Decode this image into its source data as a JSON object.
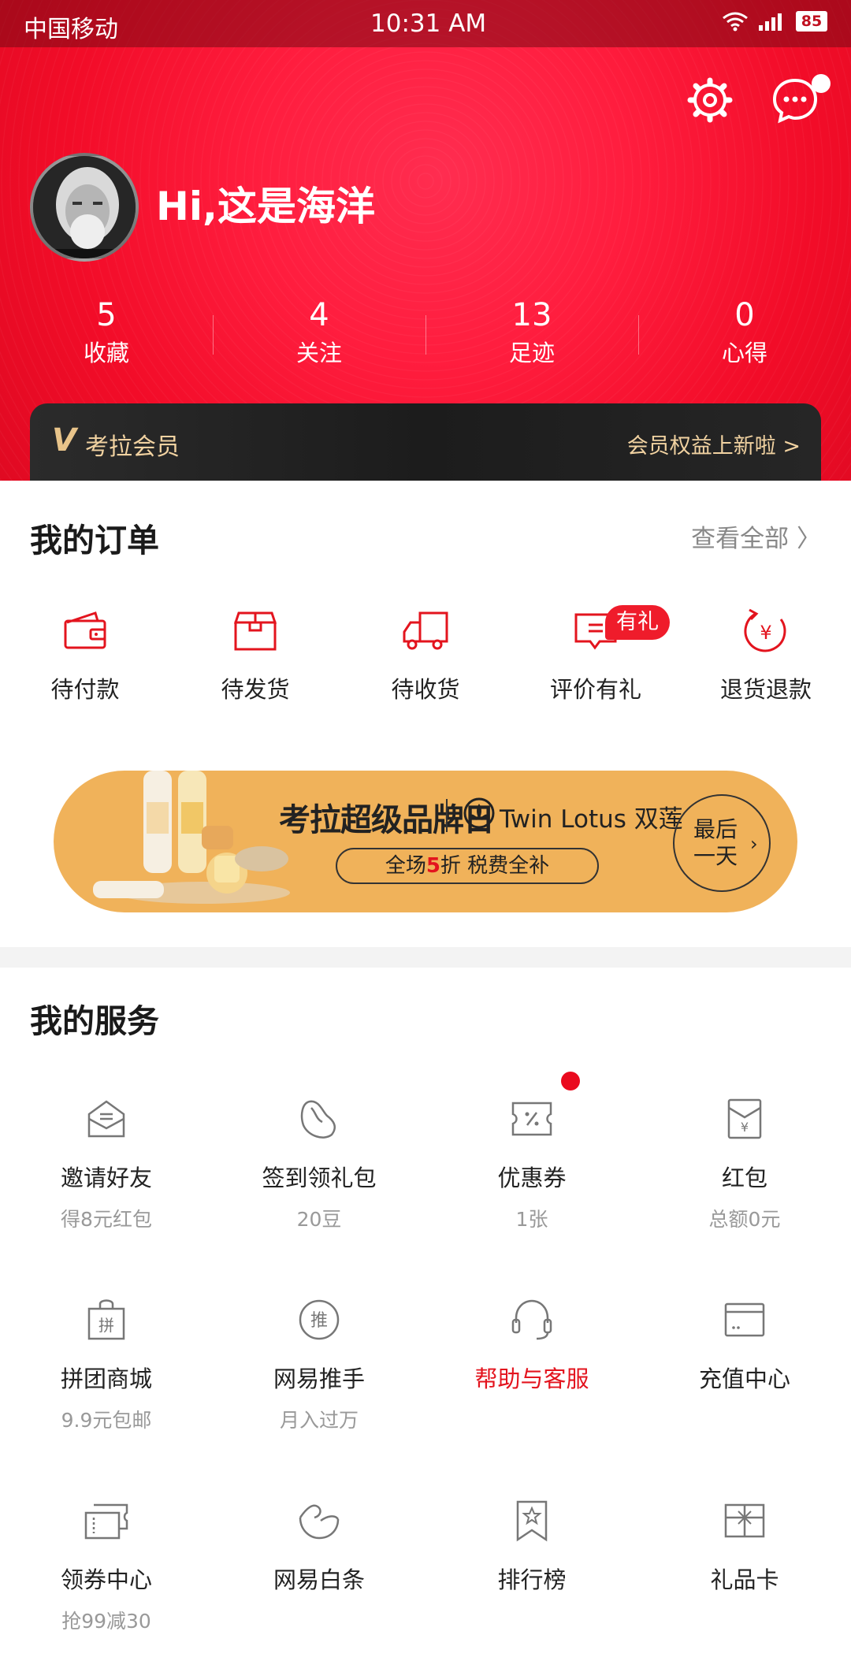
{
  "status_bar": {
    "carrier": "中国移动",
    "time": "10:31 AM",
    "battery": "85"
  },
  "header": {
    "greeting": "Hi,这是海洋",
    "stats": [
      {
        "value": "5",
        "label": "收藏"
      },
      {
        "value": "4",
        "label": "关注"
      },
      {
        "value": "13",
        "label": "足迹"
      },
      {
        "value": "0",
        "label": "心得"
      }
    ],
    "vip": {
      "mark": "V",
      "title": "考拉会员",
      "promo": "会员权益上新啦 >"
    }
  },
  "orders": {
    "title": "我的订单",
    "view_all": "查看全部 〉",
    "badge": "有礼",
    "items": [
      {
        "label": "待付款",
        "icon": "wallet-icon"
      },
      {
        "label": "待发货",
        "icon": "package-icon"
      },
      {
        "label": "待收货",
        "icon": "truck-icon"
      },
      {
        "label": "评价有礼",
        "icon": "comment-icon"
      },
      {
        "label": "退货退款",
        "icon": "refund-icon"
      }
    ]
  },
  "banner": {
    "headline": "考拉超级品牌日",
    "brand": "Twin Lotus 双莲",
    "sub_prefix": "全场",
    "sub_highlight": "5",
    "sub_suffix": "折 税费全补",
    "last_day_1": "最后",
    "last_day_2": "一天",
    "arrow": "›"
  },
  "services": {
    "title": "我的服务",
    "rows": [
      [
        {
          "label": "邀请好友",
          "sub": "得8元红包",
          "icon": "invite-envelope-icon"
        },
        {
          "label": "签到领礼包",
          "sub": "20豆",
          "icon": "bean-icon"
        },
        {
          "label": "优惠券",
          "sub": "1张",
          "icon": "coupon-icon"
        },
        {
          "label": "红包",
          "sub": "总额0元",
          "icon": "red-packet-icon"
        }
      ],
      [
        {
          "label": "拼团商城",
          "sub": "9.9元包邮",
          "icon": "group-buy-bag-icon"
        },
        {
          "label": "网易推手",
          "sub": "月入过万",
          "icon": "promoter-icon"
        },
        {
          "label": "帮助与客服",
          "sub": "",
          "icon": "headset-icon"
        },
        {
          "label": "充值中心",
          "sub": "",
          "icon": "card-icon"
        }
      ],
      [
        {
          "label": "领券中心",
          "sub": "抢99减30",
          "icon": "ticket-icon"
        },
        {
          "label": "网易白条",
          "sub": "",
          "icon": "credit-icon"
        },
        {
          "label": "排行榜",
          "sub": "",
          "icon": "ranking-icon"
        },
        {
          "label": "礼品卡",
          "sub": "",
          "icon": "gift-card-icon"
        }
      ]
    ]
  },
  "colors": {
    "brand_red": "#ef1c2b",
    "vip_gold": "#f1d2a1",
    "banner_orange": "#f0b25a"
  }
}
